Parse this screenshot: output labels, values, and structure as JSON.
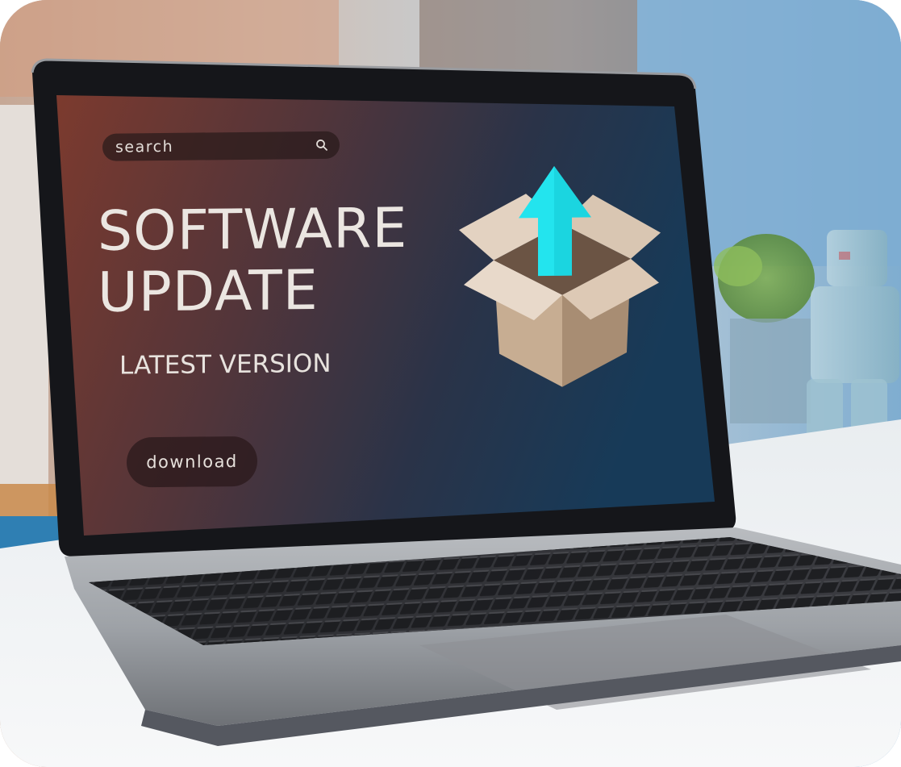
{
  "screen": {
    "search": {
      "placeholder": "search",
      "icon": "search-icon"
    },
    "title_line1": "SOFTWARE",
    "title_line2": "UPDATE",
    "subtitle": "LATEST VERSION",
    "download_label": "download",
    "illustration": {
      "box": "open-cardboard-box",
      "arrow_icon": "upload-arrow-icon",
      "arrow_color": "#23e4ee"
    }
  },
  "colors": {
    "screen_left": "#7a3b30",
    "screen_right": "#163552",
    "wall_blue": "#8fb6d3"
  }
}
